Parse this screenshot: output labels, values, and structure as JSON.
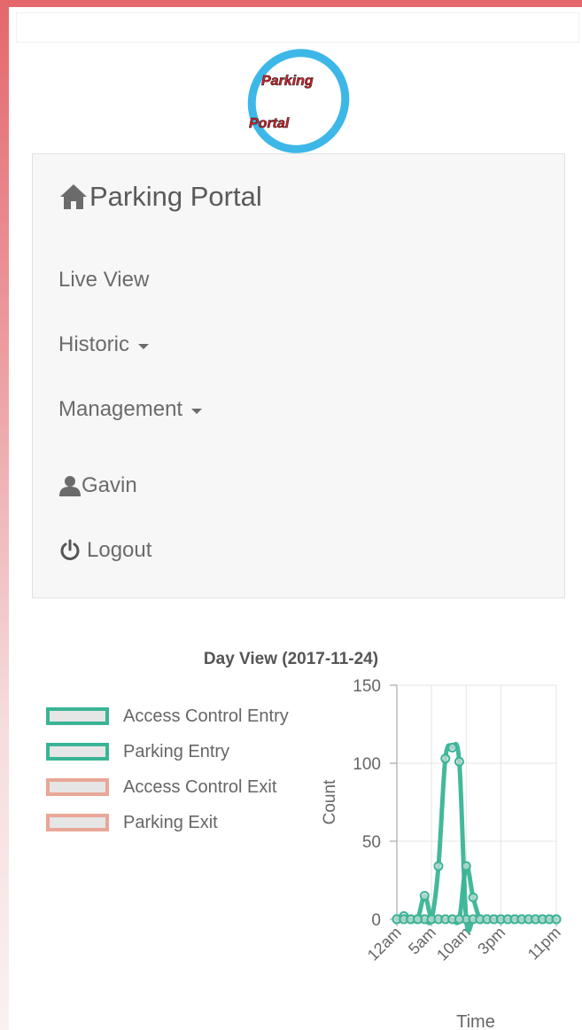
{
  "logo": {
    "line1": "Parking",
    "line2": "Portal"
  },
  "nav": {
    "brand": "Parking Portal",
    "items": [
      {
        "label": "Live View"
      },
      {
        "label": "Historic"
      },
      {
        "label": "Management"
      }
    ],
    "user": "Gavin",
    "logout": "Logout"
  },
  "colors": {
    "entry": "#3ab496",
    "exit": "#e8a797",
    "accent": "#3ab496"
  },
  "chart_data": {
    "type": "line",
    "title": "Day View (2017-11-24)",
    "xlabel": "Time",
    "ylabel": "Count",
    "ylim": [
      0,
      150
    ],
    "yticks": [
      0,
      50,
      100,
      150
    ],
    "x": [
      0,
      1,
      2,
      3,
      4,
      5,
      6,
      7,
      8,
      9,
      10,
      11,
      12,
      13,
      14,
      15,
      16,
      17,
      18,
      19,
      20,
      21,
      22,
      23
    ],
    "xtick_labels": [
      "12am",
      "5am",
      "10am",
      "3pm",
      "11pm"
    ],
    "xtick_hours": [
      0,
      5,
      10,
      15,
      23
    ],
    "grid": true,
    "legend_position": "left",
    "series": [
      {
        "name": "Access Control Entry",
        "color": "#3ab496",
        "values": [
          0,
          0,
          0,
          0,
          15,
          0,
          0,
          0,
          0,
          0,
          34,
          14,
          0,
          0,
          0,
          0,
          0,
          0,
          0,
          0,
          0,
          0,
          0,
          0
        ]
      },
      {
        "name": "Parking Entry",
        "color": "#3ab496",
        "values": [
          0,
          2,
          0,
          0,
          0,
          0,
          34,
          103,
          110,
          101,
          0,
          0,
          0,
          0,
          0,
          0,
          0,
          0,
          0,
          0,
          0,
          0,
          0,
          0
        ]
      },
      {
        "name": "Access Control Exit",
        "color": "#e8a797",
        "values": [
          0,
          0,
          0,
          0,
          0,
          0,
          0,
          0,
          0,
          0,
          0,
          0,
          0,
          0,
          0,
          0,
          0,
          0,
          0,
          0,
          0,
          0,
          0,
          0
        ]
      },
      {
        "name": "Parking Exit",
        "color": "#e8a797",
        "values": [
          0,
          0,
          0,
          0,
          0,
          0,
          0,
          0,
          0,
          0,
          0,
          0,
          0,
          0,
          0,
          0,
          0,
          0,
          0,
          0,
          0,
          0,
          0,
          0
        ]
      }
    ]
  }
}
